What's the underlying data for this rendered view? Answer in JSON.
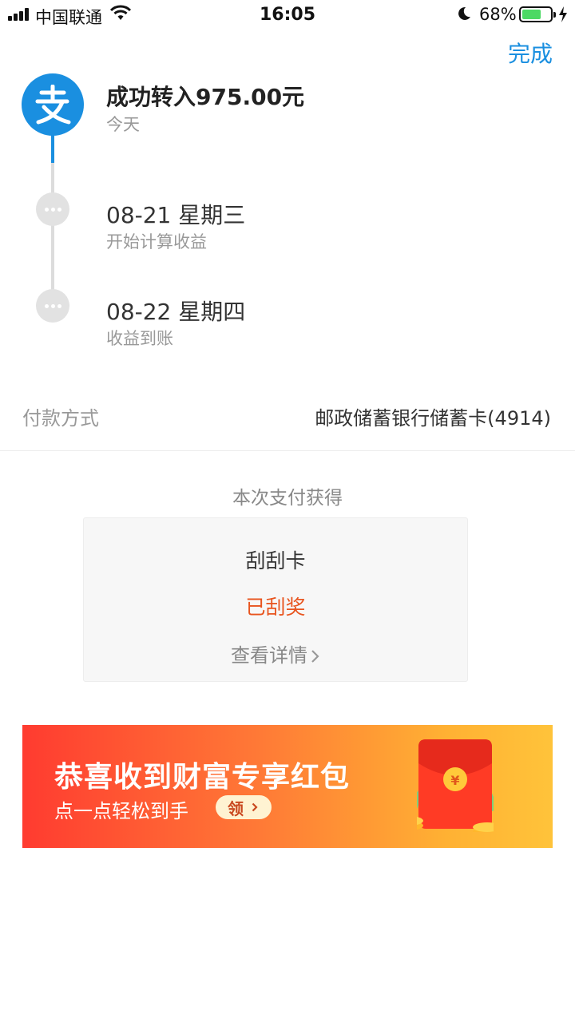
{
  "status_bar": {
    "carrier": "中国联通",
    "time": "16:05",
    "battery_percent": "68%",
    "battery_level": 0.68
  },
  "header": {
    "done_label": "完成"
  },
  "timeline": [
    {
      "title": "成功转入975.00元",
      "subtitle": "今天"
    },
    {
      "title": "08-21 星期三",
      "subtitle": "开始计算收益"
    },
    {
      "title": "08-22 星期四",
      "subtitle": "收益到账"
    }
  ],
  "payment": {
    "label": "付款方式",
    "value": "邮政储蓄银行储蓄卡(4914)"
  },
  "reward": {
    "section_title": "本次支付获得",
    "card_name": "刮刮卡",
    "card_status": "已刮奖",
    "details_link": "查看详情"
  },
  "banner": {
    "title": "恭喜收到财富专享红包",
    "subtitle": "点一点轻松到手",
    "claim_label": "领"
  },
  "colors": {
    "accent": "#1a8fe0",
    "status_orange": "#e8541e",
    "banner_start": "#ff3b30",
    "banner_end": "#ffc33a"
  },
  "icons": [
    "signal-icon",
    "wifi-icon",
    "moon-icon",
    "battery-icon",
    "charging-bolt-icon",
    "alipay-logo-icon",
    "more-dots-icon",
    "chevron-right-icon",
    "red-packet-icon"
  ]
}
